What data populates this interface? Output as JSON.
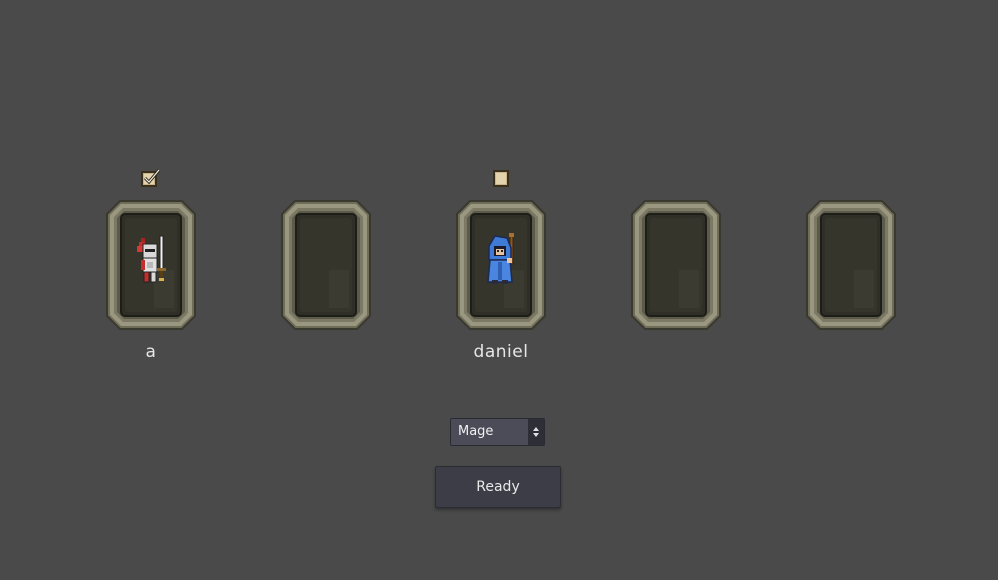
{
  "lobby": {
    "slots": [
      {
        "player_name": "a",
        "ready_checkbox": "checked",
        "character_icon": "knight-icon"
      },
      {
        "player_name": "",
        "ready_checkbox": "none",
        "character_icon": ""
      },
      {
        "player_name": "daniel",
        "ready_checkbox": "unchecked",
        "character_icon": "mage-icon"
      },
      {
        "player_name": "",
        "ready_checkbox": "none",
        "character_icon": ""
      },
      {
        "player_name": "",
        "ready_checkbox": "none",
        "character_icon": ""
      }
    ]
  },
  "class_select": {
    "selected": "Mage"
  },
  "ready_button": {
    "label": "Ready"
  },
  "colors": {
    "background": "#4a4a4a",
    "frame_stone": "#8a8770",
    "card_interior": "#2f2f27",
    "button_bg": "#3d3d47"
  }
}
